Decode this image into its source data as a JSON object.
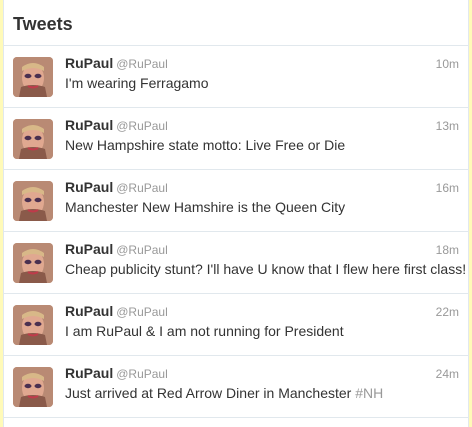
{
  "section": {
    "title": "Tweets"
  },
  "tweets": [
    {
      "name": "RuPaul",
      "handle": "@RuPaul",
      "time": "10m",
      "text": "I'm wearing Ferragamo",
      "hashtag": ""
    },
    {
      "name": "RuPaul",
      "handle": "@RuPaul",
      "time": "13m",
      "text": "New Hampshire state motto: Live Free or Die",
      "hashtag": ""
    },
    {
      "name": "RuPaul",
      "handle": "@RuPaul",
      "time": "16m",
      "text": "Manchester New Hamshire is the Queen City",
      "hashtag": ""
    },
    {
      "name": "RuPaul",
      "handle": "@RuPaul",
      "time": "18m",
      "text": "Cheap publicity stunt? I'll have U know that I flew here first class!",
      "hashtag": ""
    },
    {
      "name": "RuPaul",
      "handle": "@RuPaul",
      "time": "22m",
      "text": "I am RuPaul & I am not running for President",
      "hashtag": ""
    },
    {
      "name": "RuPaul",
      "handle": "@RuPaul",
      "time": "24m",
      "text": "Just arrived at Red Arrow Diner in Manchester ",
      "hashtag": "#NH"
    }
  ],
  "colors": {
    "page_background": "#fffab8",
    "card_background": "#ffffff",
    "divider": "#e1e8ed",
    "primary_text": "#333333",
    "muted_text": "#999999"
  },
  "icons": {
    "avatar": "profile-photo"
  }
}
